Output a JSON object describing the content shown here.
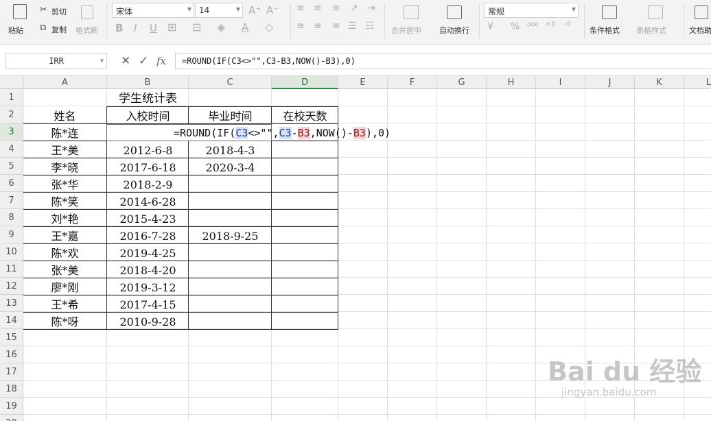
{
  "ribbon": {
    "paste_label": "粘贴",
    "cut_label": "剪切",
    "copy_label": "复制",
    "format_painter_label": "格式刷",
    "font_name": "宋体",
    "font_size": "14",
    "number_format": "常规",
    "merge_center_label": "合并居中",
    "wrap_text_label": "自动换行",
    "conditional_format_label": "条件格式",
    "table_style_label": "表格样式",
    "doc_assistant_label": "文档助"
  },
  "formula_bar": {
    "name_box": "IRR",
    "formula": "=ROUND(IF(C3<>\"\",C3-B3,NOW()-B3),0)"
  },
  "columns": [
    "A",
    "B",
    "C",
    "D",
    "E",
    "F",
    "G",
    "H",
    "I",
    "J",
    "K",
    "L"
  ],
  "rows": [
    "1",
    "2",
    "3",
    "4",
    "5",
    "6",
    "7",
    "8",
    "9",
    "10",
    "11",
    "12",
    "13",
    "14",
    "15",
    "16",
    "17",
    "18",
    "19",
    "20"
  ],
  "sheet": {
    "title": "学生统计表",
    "headers": [
      "姓名",
      "入校时间",
      "毕业时间",
      "在校天数"
    ],
    "records": [
      {
        "name": "陈*连",
        "start": "",
        "end": ""
      },
      {
        "name": "王*美",
        "start": "2012-6-8",
        "end": "2018-4-3"
      },
      {
        "name": "李*晓",
        "start": "2017-6-18",
        "end": "2020-3-4"
      },
      {
        "name": "张*华",
        "start": "2018-2-9",
        "end": ""
      },
      {
        "name": "陈*笑",
        "start": "2014-6-28",
        "end": ""
      },
      {
        "name": "刘*艳",
        "start": "2015-4-23",
        "end": ""
      },
      {
        "name": "王*嘉",
        "start": "2016-7-28",
        "end": "2018-9-25"
      },
      {
        "name": "陈*欢",
        "start": "2019-4-25",
        "end": ""
      },
      {
        "name": "张*美",
        "start": "2018-4-20",
        "end": ""
      },
      {
        "name": "廖*刚",
        "start": "2019-3-12",
        "end": ""
      },
      {
        "name": "王*希",
        "start": "2017-4-15",
        "end": ""
      },
      {
        "name": "陈*呀",
        "start": "2010-9-28",
        "end": ""
      }
    ]
  },
  "edit": {
    "p1": "=ROUND(IF(",
    "r1": "C3",
    "p2": "<>\"\",",
    "r2": "C3",
    "p3": "-",
    "r3": "B3",
    "p4": ",NOW()-",
    "r4": "B3",
    "p5": "),0)"
  },
  "watermark": {
    "brand": "Bai du 经验",
    "url": "jingyan.baidu.com"
  }
}
